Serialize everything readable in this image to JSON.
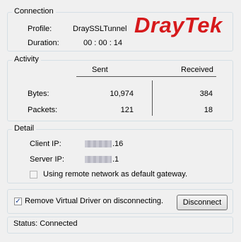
{
  "connection": {
    "title": "Connection",
    "profile_label": "Profile:",
    "profile_value": "DraySSLTunnel",
    "duration_label": "Duration:",
    "duration_value": "00 : 00 : 14",
    "logo_text": "DrayTek"
  },
  "activity": {
    "title": "Activity",
    "col_sent": "Sent",
    "col_received": "Received",
    "rows": [
      {
        "label": "Bytes:",
        "sent": "10,974",
        "received": "384"
      },
      {
        "label": "Packets:",
        "sent": "121",
        "received": "18"
      }
    ]
  },
  "detail": {
    "title": "Detail",
    "client_ip_label": "Client IP:",
    "client_ip_suffix": ".16",
    "server_ip_label": "Server IP:",
    "server_ip_suffix": ".1",
    "default_gateway_label": "Using remote network as default gateway.",
    "default_gateway_checked": false
  },
  "remove_driver": {
    "label": "Remove Virtual Driver on disconnecting.",
    "checked": true
  },
  "disconnect_label": "Disconnect",
  "status_text": "Status: Connected",
  "colors": {
    "logo": "#d6191b",
    "group_border": "#d5dfe5",
    "background": "#f0f0f0"
  }
}
